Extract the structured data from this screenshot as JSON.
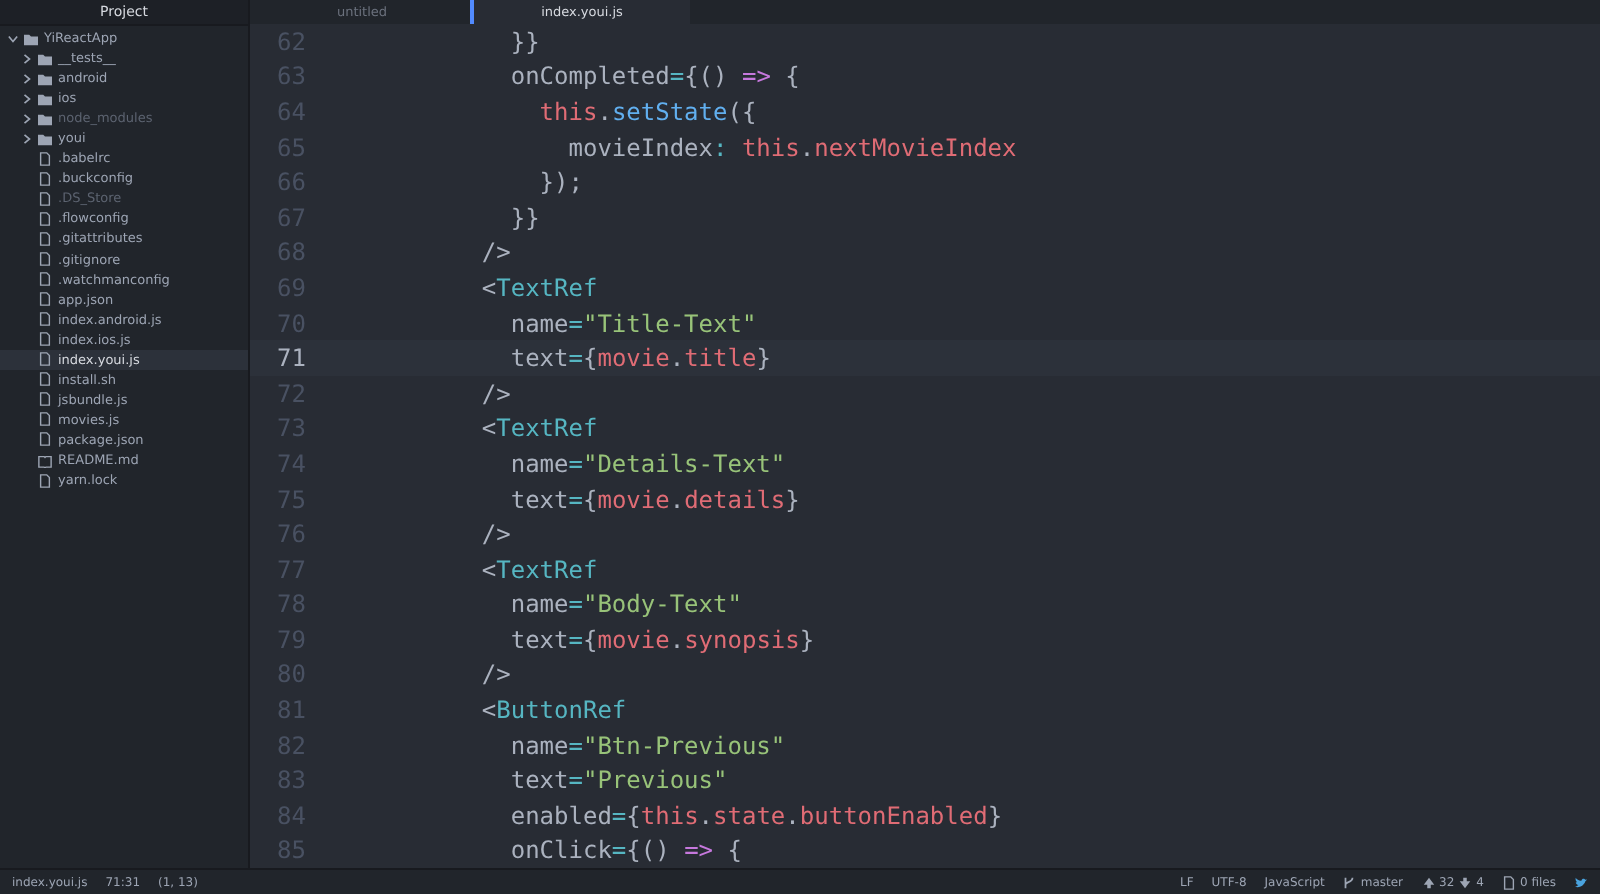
{
  "sidebar": {
    "title": "Project",
    "tree": [
      {
        "name": "YiReactApp",
        "kind": "folder",
        "expanded": true,
        "ignored": false,
        "selected": false,
        "children": [
          {
            "name": "__tests__",
            "kind": "folder",
            "expanded": false,
            "ignored": false,
            "selected": false
          },
          {
            "name": "android",
            "kind": "folder",
            "expanded": false,
            "ignored": false,
            "selected": false
          },
          {
            "name": "ios",
            "kind": "folder",
            "expanded": false,
            "ignored": false,
            "selected": false
          },
          {
            "name": "node_modules",
            "kind": "folder",
            "expanded": false,
            "ignored": true,
            "selected": false
          },
          {
            "name": "youi",
            "kind": "folder",
            "expanded": false,
            "ignored": false,
            "selected": false
          },
          {
            "name": ".babelrc",
            "kind": "file",
            "ignored": false,
            "selected": false
          },
          {
            "name": ".buckconfig",
            "kind": "file",
            "ignored": false,
            "selected": false
          },
          {
            "name": ".DS_Store",
            "kind": "file",
            "ignored": true,
            "selected": false
          },
          {
            "name": ".flowconfig",
            "kind": "file",
            "ignored": false,
            "selected": false
          },
          {
            "name": ".gitattributes",
            "kind": "file",
            "ignored": false,
            "selected": false
          },
          {
            "name": ".gitignore",
            "kind": "file",
            "ignored": false,
            "selected": false
          },
          {
            "name": ".watchmanconfig",
            "kind": "file",
            "ignored": false,
            "selected": false
          },
          {
            "name": "app.json",
            "kind": "file",
            "ignored": false,
            "selected": false
          },
          {
            "name": "index.android.js",
            "kind": "file",
            "ignored": false,
            "selected": false
          },
          {
            "name": "index.ios.js",
            "kind": "file",
            "ignored": false,
            "selected": false
          },
          {
            "name": "index.youi.js",
            "kind": "file",
            "ignored": false,
            "selected": true
          },
          {
            "name": "install.sh",
            "kind": "file",
            "ignored": false,
            "selected": false
          },
          {
            "name": "jsbundle.js",
            "kind": "file",
            "ignored": false,
            "selected": false
          },
          {
            "name": "movies.js",
            "kind": "file",
            "ignored": false,
            "selected": false
          },
          {
            "name": "package.json",
            "kind": "file",
            "ignored": false,
            "selected": false
          },
          {
            "name": "README.md",
            "kind": "book",
            "ignored": false,
            "selected": false
          },
          {
            "name": "yarn.lock",
            "kind": "file",
            "ignored": false,
            "selected": false
          }
        ]
      }
    ]
  },
  "tabs": [
    {
      "label": "untitled",
      "selected": false
    },
    {
      "label": "index.youi.js",
      "selected": true
    }
  ],
  "editor": {
    "lines": [
      {
        "number": "62",
        "current": false,
        "tokens": [
          {
            "kind": "plain",
            "text": "      }}"
          }
        ]
      },
      {
        "number": "63",
        "current": false,
        "tokens": [
          {
            "kind": "plain",
            "text": "      onCompleted"
          },
          {
            "kind": "op",
            "text": "="
          },
          {
            "kind": "plain",
            "text": "{() "
          },
          {
            "kind": "keyword",
            "text": "=>"
          },
          {
            "kind": "plain",
            "text": " {"
          }
        ]
      },
      {
        "number": "64",
        "current": false,
        "tokens": [
          {
            "kind": "var",
            "text": "        this"
          },
          {
            "kind": "plain",
            "text": "."
          },
          {
            "kind": "func",
            "text": "setState"
          },
          {
            "kind": "plain",
            "text": "({"
          }
        ]
      },
      {
        "number": "65",
        "current": false,
        "tokens": [
          {
            "kind": "plain",
            "text": "          movieIndex"
          },
          {
            "kind": "op",
            "text": ":"
          },
          {
            "kind": "var",
            "text": " this"
          },
          {
            "kind": "plain",
            "text": "."
          },
          {
            "kind": "var",
            "text": "nextMovieIndex"
          }
        ]
      },
      {
        "number": "66",
        "current": false,
        "tokens": [
          {
            "kind": "plain",
            "text": "        });"
          }
        ]
      },
      {
        "number": "67",
        "current": false,
        "tokens": [
          {
            "kind": "plain",
            "text": "      }}"
          }
        ]
      },
      {
        "number": "68",
        "current": false,
        "tokens": [
          {
            "kind": "plain",
            "text": "    />"
          }
        ]
      },
      {
        "number": "69",
        "current": false,
        "tokens": [
          {
            "kind": "plain",
            "text": "    <"
          },
          {
            "kind": "tag",
            "text": "TextRef"
          }
        ]
      },
      {
        "number": "70",
        "current": false,
        "tokens": [
          {
            "kind": "plain",
            "text": "      name"
          },
          {
            "kind": "op",
            "text": "="
          },
          {
            "kind": "string",
            "text": "\"Title-Text\""
          }
        ]
      },
      {
        "number": "71",
        "current": true,
        "tokens": [
          {
            "kind": "plain",
            "text": "      text"
          },
          {
            "kind": "op",
            "text": "="
          },
          {
            "kind": "plain",
            "text": "{"
          },
          {
            "kind": "var",
            "text": "movie"
          },
          {
            "kind": "plain",
            "text": "."
          },
          {
            "kind": "var",
            "text": "title"
          },
          {
            "kind": "plain",
            "text": "}"
          }
        ]
      },
      {
        "number": "72",
        "current": false,
        "tokens": [
          {
            "kind": "plain",
            "text": "    />"
          }
        ]
      },
      {
        "number": "73",
        "current": false,
        "tokens": [
          {
            "kind": "plain",
            "text": "    <"
          },
          {
            "kind": "tag",
            "text": "TextRef"
          }
        ]
      },
      {
        "number": "74",
        "current": false,
        "tokens": [
          {
            "kind": "plain",
            "text": "      name"
          },
          {
            "kind": "op",
            "text": "="
          },
          {
            "kind": "string",
            "text": "\"Details-Text\""
          }
        ]
      },
      {
        "number": "75",
        "current": false,
        "tokens": [
          {
            "kind": "plain",
            "text": "      text"
          },
          {
            "kind": "op",
            "text": "="
          },
          {
            "kind": "plain",
            "text": "{"
          },
          {
            "kind": "var",
            "text": "movie"
          },
          {
            "kind": "plain",
            "text": "."
          },
          {
            "kind": "var",
            "text": "details"
          },
          {
            "kind": "plain",
            "text": "}"
          }
        ]
      },
      {
        "number": "76",
        "current": false,
        "tokens": [
          {
            "kind": "plain",
            "text": "    />"
          }
        ]
      },
      {
        "number": "77",
        "current": false,
        "tokens": [
          {
            "kind": "plain",
            "text": "    <"
          },
          {
            "kind": "tag",
            "text": "TextRef"
          }
        ]
      },
      {
        "number": "78",
        "current": false,
        "tokens": [
          {
            "kind": "plain",
            "text": "      name"
          },
          {
            "kind": "op",
            "text": "="
          },
          {
            "kind": "string",
            "text": "\"Body-Text\""
          }
        ]
      },
      {
        "number": "79",
        "current": false,
        "tokens": [
          {
            "kind": "plain",
            "text": "      text"
          },
          {
            "kind": "op",
            "text": "="
          },
          {
            "kind": "plain",
            "text": "{"
          },
          {
            "kind": "var",
            "text": "movie"
          },
          {
            "kind": "plain",
            "text": "."
          },
          {
            "kind": "var",
            "text": "synopsis"
          },
          {
            "kind": "plain",
            "text": "}"
          }
        ]
      },
      {
        "number": "80",
        "current": false,
        "tokens": [
          {
            "kind": "plain",
            "text": "    />"
          }
        ]
      },
      {
        "number": "81",
        "current": false,
        "tokens": [
          {
            "kind": "plain",
            "text": "    <"
          },
          {
            "kind": "tag",
            "text": "ButtonRef"
          }
        ]
      },
      {
        "number": "82",
        "current": false,
        "tokens": [
          {
            "kind": "plain",
            "text": "      name"
          },
          {
            "kind": "op",
            "text": "="
          },
          {
            "kind": "string",
            "text": "\"Btn-Previous\""
          }
        ]
      },
      {
        "number": "83",
        "current": false,
        "tokens": [
          {
            "kind": "plain",
            "text": "      text"
          },
          {
            "kind": "op",
            "text": "="
          },
          {
            "kind": "string",
            "text": "\"Previous\""
          }
        ]
      },
      {
        "number": "84",
        "current": false,
        "tokens": [
          {
            "kind": "plain",
            "text": "      enabled"
          },
          {
            "kind": "op",
            "text": "="
          },
          {
            "kind": "plain",
            "text": "{"
          },
          {
            "kind": "var",
            "text": "this"
          },
          {
            "kind": "plain",
            "text": "."
          },
          {
            "kind": "var",
            "text": "state"
          },
          {
            "kind": "plain",
            "text": "."
          },
          {
            "kind": "var",
            "text": "buttonEnabled"
          },
          {
            "kind": "plain",
            "text": "}"
          }
        ]
      },
      {
        "number": "85",
        "current": false,
        "tokens": [
          {
            "kind": "plain",
            "text": "      onClick"
          },
          {
            "kind": "op",
            "text": "="
          },
          {
            "kind": "plain",
            "text": "{() "
          },
          {
            "kind": "keyword",
            "text": "=>"
          },
          {
            "kind": "plain",
            "text": " {"
          }
        ]
      }
    ]
  },
  "status_bar": {
    "file": "index.youi.js",
    "cursor": "71:31",
    "selection": "(1, 13)",
    "line_ending": "LF",
    "encoding": "UTF-8",
    "grammar": "JavaScript",
    "branch": "master",
    "ahead": "32",
    "behind": "4",
    "changed_files": "0 files"
  }
}
